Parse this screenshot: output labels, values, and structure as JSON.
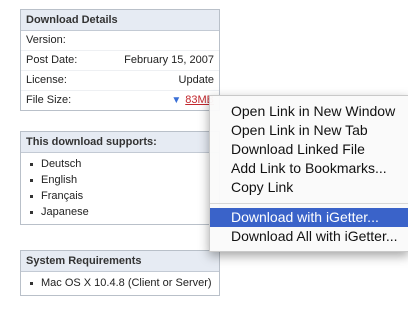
{
  "download_details": {
    "title": "Download Details",
    "rows": [
      {
        "label": "Version:",
        "value": ""
      },
      {
        "label": "Post Date:",
        "value": "February 15, 2007"
      },
      {
        "label": "License:",
        "value": "Update"
      },
      {
        "label": "File Size:",
        "value": "83MB"
      }
    ],
    "download_icon": "download-arrow-icon"
  },
  "supports": {
    "title": "This download supports:",
    "languages": [
      "Deutsch",
      "English",
      "Français",
      "Japanese"
    ]
  },
  "requirements": {
    "title": "System Requirements",
    "items": [
      "Mac OS X 10.4.8 (Client or Server)"
    ]
  },
  "context_menu": {
    "items": [
      "Open Link in New Window",
      "Open Link in New Tab",
      "Download Linked File",
      "Add Link to Bookmarks...",
      "Copy Link",
      "Download with iGetter...",
      "Download All with iGetter..."
    ],
    "highlighted_item": "Download with iGetter...",
    "highlight_color": "#3a63c9"
  }
}
